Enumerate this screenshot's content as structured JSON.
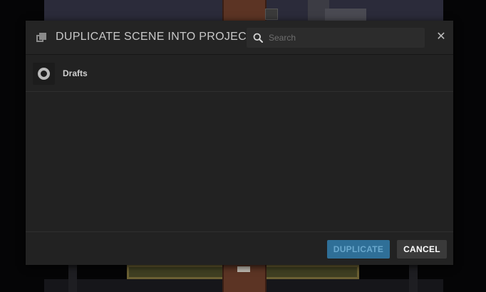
{
  "dialog": {
    "title": "DUPLICATE SCENE INTO PROJECT",
    "icon": "duplicate-icon",
    "close_icon": "close-icon",
    "close_glyph": "✕"
  },
  "search": {
    "placeholder": "Search",
    "value": "",
    "icon": "search-icon"
  },
  "projects": [
    {
      "name": "Drafts",
      "icon": "ring-icon"
    }
  ],
  "footer": {
    "duplicate_label": "DUPLICATE",
    "cancel_label": "CANCEL"
  },
  "colors": {
    "modal_bg": "#222222",
    "accent": "#2f6f97",
    "accent_text": "#6aa8cd",
    "cancel_bg": "#3a3a3a"
  }
}
